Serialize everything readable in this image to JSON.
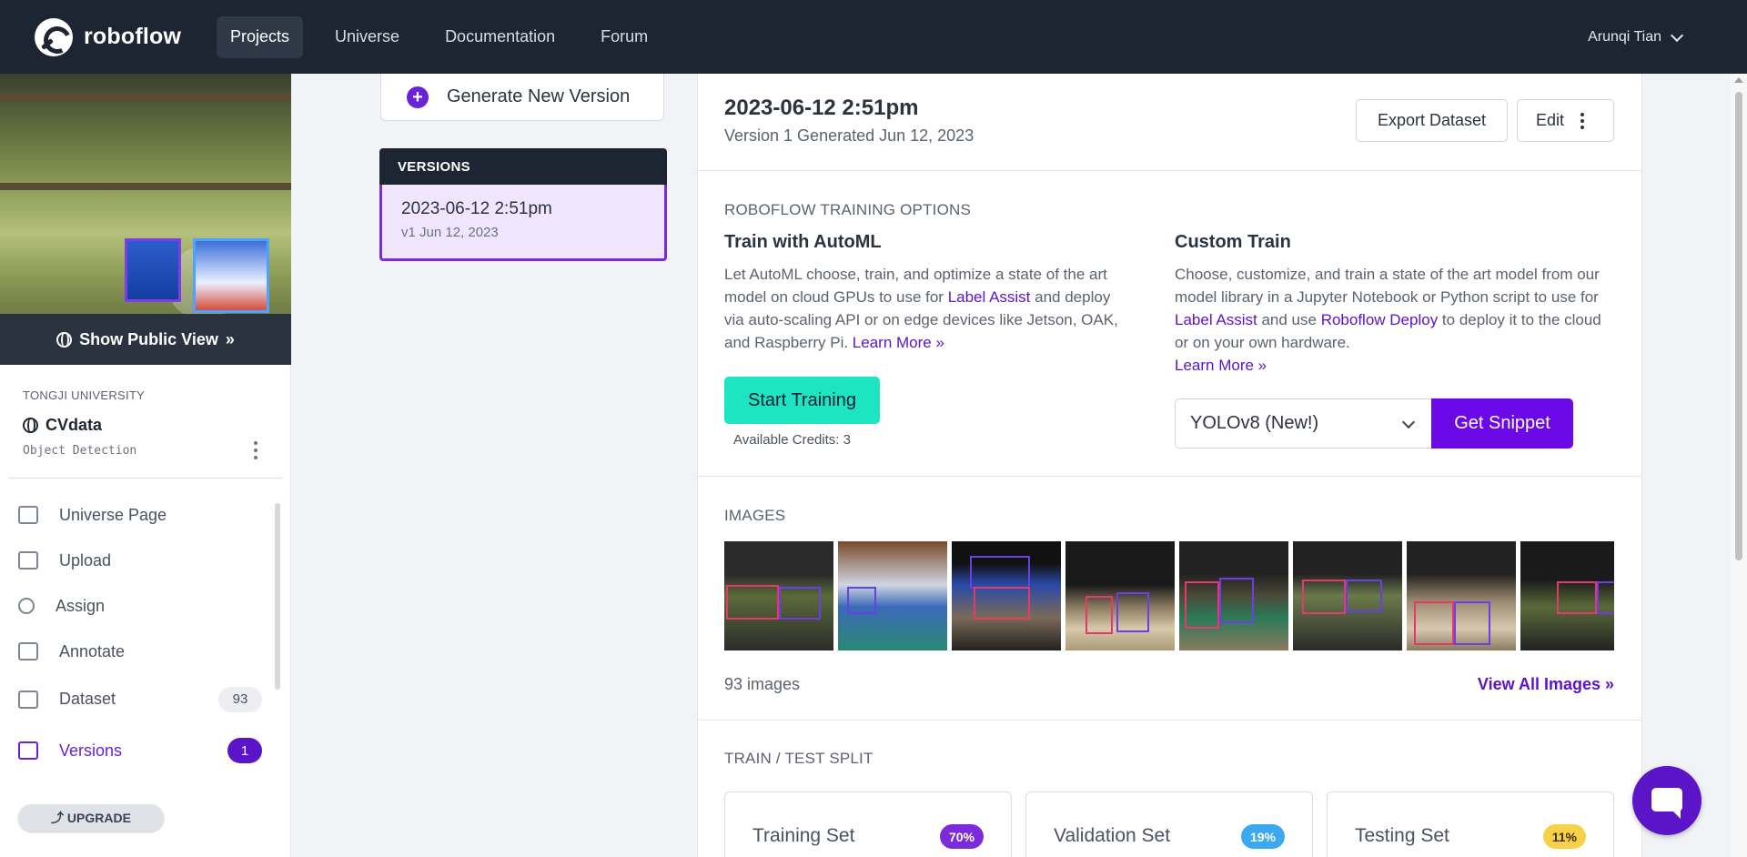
{
  "nav": {
    "brand": "roboflow",
    "links": [
      {
        "label": "Projects",
        "active": true
      },
      {
        "label": "Universe",
        "active": false
      },
      {
        "label": "Documentation",
        "active": false
      },
      {
        "label": "Forum",
        "active": false
      }
    ],
    "user": "Arunqi Tian"
  },
  "sidebar": {
    "show_public_view": "Show Public View",
    "show_public_arrows": "»",
    "org": "TONGJI UNIVERSITY",
    "project_name": "CVdata",
    "project_type": "Object Detection",
    "menu": [
      {
        "label": "Universe Page",
        "icon": "page-icon"
      },
      {
        "label": "Upload",
        "icon": "upload-icon"
      },
      {
        "label": "Assign",
        "icon": "search-icon"
      },
      {
        "label": "Annotate",
        "icon": "annotate-icon"
      },
      {
        "label": "Dataset",
        "icon": "dataset-icon",
        "count": "93"
      },
      {
        "label": "Versions",
        "icon": "folder-icon",
        "count": "1",
        "active": true
      }
    ],
    "upgrade": "⤴ UPGRADE"
  },
  "versions": {
    "generate_label": "Generate New Version",
    "header": "VERSIONS",
    "items": [
      {
        "title": "2023-06-12 2:51pm",
        "subtitle": "v1 Jun 12, 2023"
      }
    ]
  },
  "main": {
    "version_title": "2023-06-12 2:51pm",
    "version_generated": "Version 1 Generated Jun 12, 2023",
    "export_label": "Export Dataset",
    "edit_label": "Edit",
    "training_options_label": "ROBOFLOW TRAINING OPTIONS",
    "automl": {
      "title": "Train with AutoML",
      "text_1": "Let AutoML choose, train, and optimize a state of the art model on cloud GPUs to use for ",
      "link_label_assist": "Label Assist",
      "text_2": " and deploy via auto-scaling API or on edge devices like Jetson, OAK, and Raspberry Pi. ",
      "link_learn_more": "Learn More »",
      "start_label": "Start Training",
      "credits": "Available Credits: 3"
    },
    "custom": {
      "title": "Custom Train",
      "text_1": "Choose, customize, and train a state of the art model from our model library in a Jupyter Notebook or Python script to use for ",
      "link_label_assist": "Label Assist",
      "text_2": " and use ",
      "link_deploy": "Roboflow Deploy",
      "text_3": " to deploy it to the cloud or on your own hardware.",
      "link_learn_more": "Learn More »",
      "model_selected": "YOLOv8 (New!)",
      "snippet_label": "Get Snippet"
    },
    "images_label": "IMAGES",
    "image_count": "93 images",
    "view_all": "View All Images »",
    "split_label": "TRAIN / TEST SPLIT",
    "splits": [
      {
        "name": "Training Set",
        "pct": "70%",
        "color": "#7c2bdb",
        "text_color": "#ffffff"
      },
      {
        "name": "Validation Set",
        "pct": "19%",
        "color": "#3aa9f0",
        "text_color": "#ffffff"
      },
      {
        "name": "Testing Set",
        "pct": "11%",
        "color": "#f7d14a",
        "text_color": "#3c3000"
      }
    ]
  },
  "colors": {
    "nav_bg": "#1e2532",
    "accent_purple": "#6a08e8",
    "start_training": "#1de5c4"
  }
}
